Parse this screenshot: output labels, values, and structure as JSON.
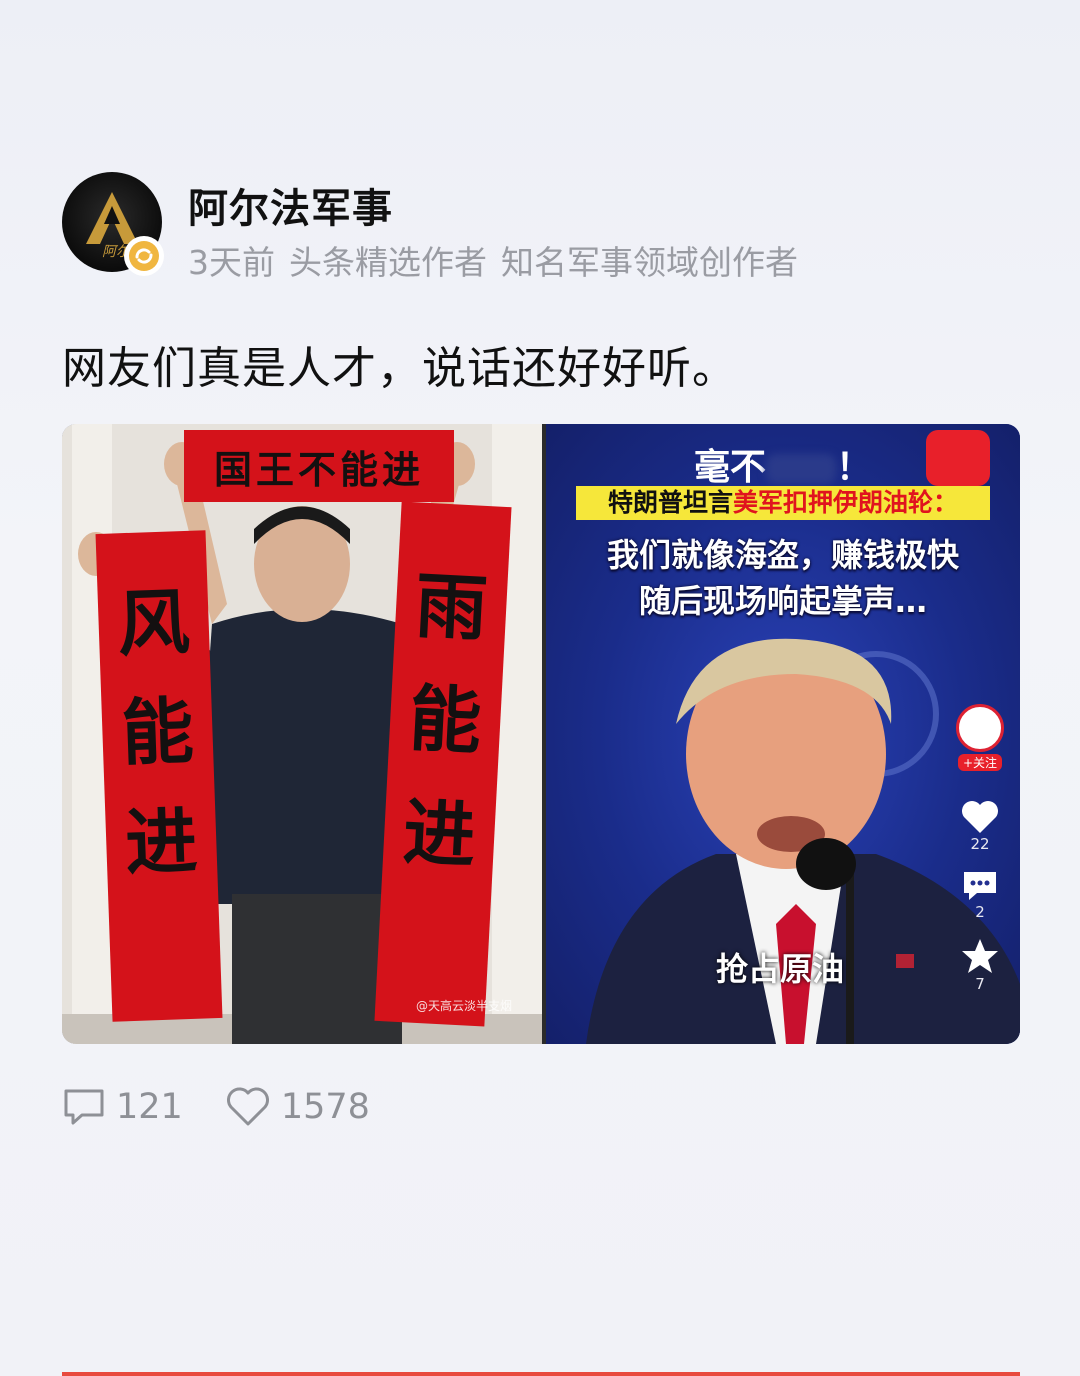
{
  "author": {
    "name": "阿尔法军事",
    "avatar_text": "阿尔",
    "verified_icon": "verified-badge-icon"
  },
  "meta": {
    "time": "3天前",
    "badge1": "头条精选作者",
    "badge2": "知名军事领域创作者"
  },
  "post": {
    "text": "网友们真是人才，说话还好好听。"
  },
  "image": {
    "left": {
      "scroll_top": "国王不能进",
      "scroll_left": [
        "风",
        "能",
        "进"
      ],
      "scroll_right": [
        "雨",
        "能",
        "进"
      ],
      "watermark": "@天高云淡半支烟"
    },
    "right": {
      "headline_top": "毫不",
      "headline_top_end": "！",
      "headline_box_a": "特朗普坦言",
      "headline_box_b": "美军扣押伊朗油轮：",
      "line1": "我们就像海盗，赚钱极快",
      "line2": "随后现场响起掌声…",
      "caption": "抢占原油",
      "follow_label": "+关注",
      "likes": "22",
      "comments": "2",
      "favorites": "7"
    }
  },
  "actions": {
    "comments": "121",
    "likes": "1578"
  },
  "colors": {
    "accent": "#e84a3e",
    "meta_text": "#9a9ca3",
    "scroll_red": "#d4121a",
    "headline_yellow": "#f6e73a"
  }
}
